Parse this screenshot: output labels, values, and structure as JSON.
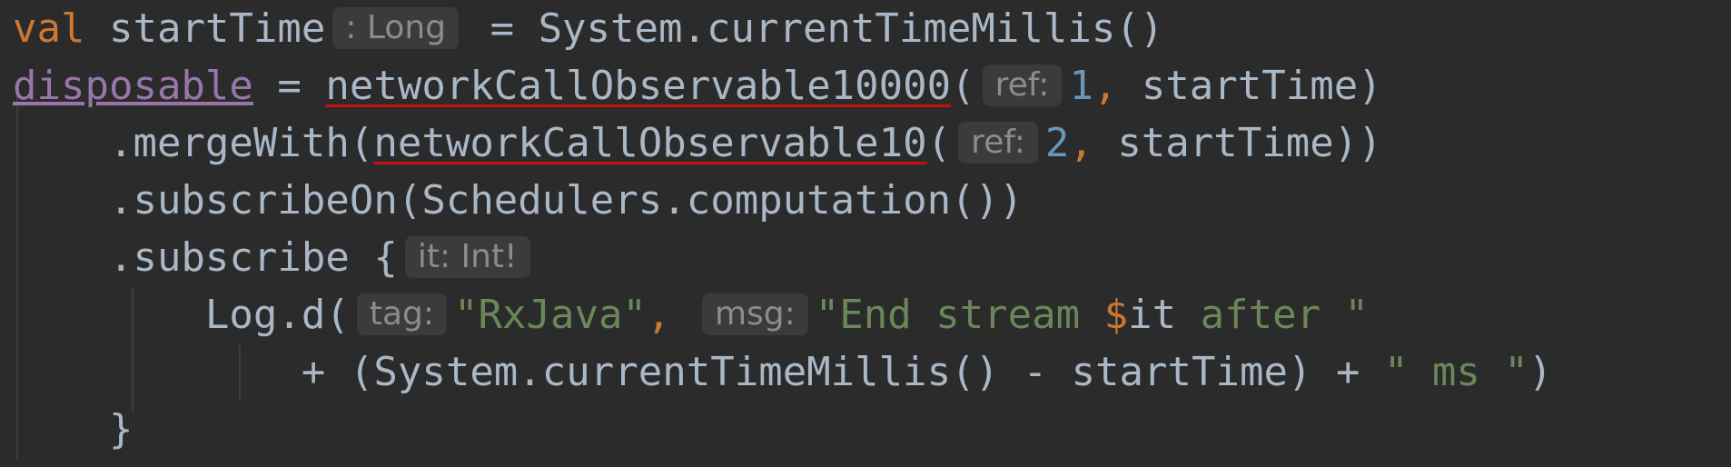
{
  "editor": {
    "lines": [
      {
        "tokens": [
          {
            "text": "val",
            "style": "keyword"
          },
          {
            "text": " startTime",
            "style": "plain"
          },
          {
            "hint": ": Long"
          },
          {
            "text": " = System.currentTimeMillis()",
            "style": "plain"
          }
        ]
      },
      {
        "tokens": [
          {
            "text": "disposable",
            "style": "property"
          },
          {
            "text": " = ",
            "style": "plain"
          },
          {
            "text": "networkCallObservable10000",
            "style": "error-underline"
          },
          {
            "text": "(",
            "style": "plain"
          },
          {
            "hint": "ref:"
          },
          {
            "text": "1",
            "style": "number"
          },
          {
            "text": ",",
            "style": "keyword"
          },
          {
            "text": " startTime)",
            "style": "plain"
          }
        ]
      },
      {
        "tokens": [
          {
            "text": "    .mergeWith(",
            "style": "plain"
          },
          {
            "text": "networkCallObservable10",
            "style": "error-underline"
          },
          {
            "text": "(",
            "style": "plain"
          },
          {
            "hint": "ref:"
          },
          {
            "text": "2",
            "style": "number"
          },
          {
            "text": ",",
            "style": "keyword"
          },
          {
            "text": " startTime))",
            "style": "plain"
          }
        ]
      },
      {
        "tokens": [
          {
            "text": "    .subscribeOn(Schedulers.computation())",
            "style": "plain"
          }
        ]
      },
      {
        "tokens": [
          {
            "text": "    .subscribe {",
            "style": "plain"
          },
          {
            "hint": "it: Int!"
          }
        ]
      },
      {
        "tokens": [
          {
            "text": "        Log.d(",
            "style": "plain"
          },
          {
            "hint": "tag:"
          },
          {
            "text": "\"RxJava\"",
            "style": "string"
          },
          {
            "text": ", ",
            "style": "keyword"
          },
          {
            "hint": "msg:"
          },
          {
            "text": "\"End stream ",
            "style": "string"
          },
          {
            "text": "$",
            "style": "template"
          },
          {
            "text": "it",
            "style": "plain"
          },
          {
            "text": " after \"",
            "style": "string"
          }
        ]
      },
      {
        "tokens": [
          {
            "text": "            + (System.currentTimeMillis() - startTime) + ",
            "style": "plain"
          },
          {
            "text": "\" ms \"",
            "style": "string"
          },
          {
            "text": ")",
            "style": "plain"
          }
        ]
      },
      {
        "tokens": [
          {
            "text": "    }",
            "style": "plain"
          }
        ]
      }
    ],
    "colors": {
      "background": "#2b2b2b",
      "plain": "#a9b7c6",
      "keyword": "#cc7832",
      "property": "#9876aa",
      "number": "#6897bb",
      "string": "#6a8759",
      "error-underline": "#c80f0f",
      "hint-background": "#3b3b3b",
      "hint-text": "#8c8c8c"
    }
  }
}
